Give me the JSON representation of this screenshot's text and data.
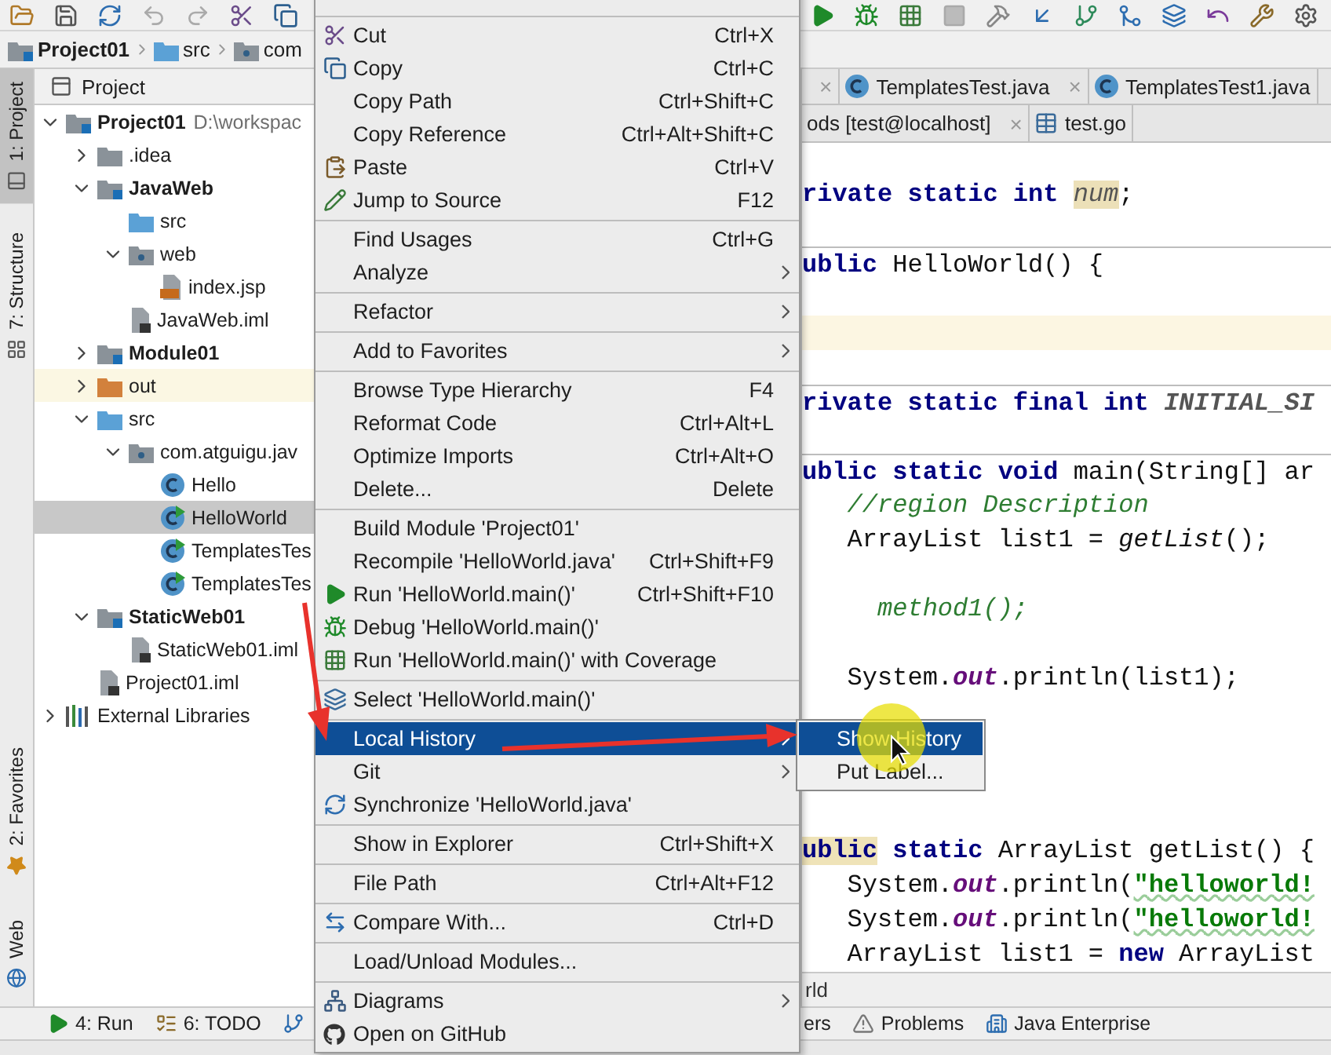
{
  "breadcrumb": [
    {
      "label": "Project01",
      "kind": "module"
    },
    {
      "label": "src",
      "kind": "src"
    },
    {
      "label": "com",
      "kind": "package"
    }
  ],
  "side_stripe": {
    "top": [
      {
        "label": "1: Project",
        "kind": "project",
        "selected": true
      },
      {
        "label": "7: Structure",
        "kind": "structure",
        "selected": false
      }
    ],
    "bottom": [
      {
        "label": "2: Favorites",
        "kind": "star",
        "selected": false
      },
      {
        "label": "Web",
        "kind": "web",
        "selected": false
      }
    ]
  },
  "project_panel": {
    "title": "Project",
    "tree": [
      {
        "label": "Project01",
        "path": "D:\\workspac",
        "kind": "module",
        "expanded": true,
        "selected": false,
        "children": [
          {
            "label": ".idea",
            "kind": "folder",
            "expanded": false,
            "selected": false
          },
          {
            "label": "JavaWeb",
            "kind": "module",
            "expanded": true,
            "selected": false,
            "children": [
              {
                "label": "src",
                "kind": "src",
                "selected": false
              },
              {
                "label": "web",
                "kind": "web",
                "expanded": true,
                "selected": false,
                "children": [
                  {
                    "label": "index.jsp",
                    "kind": "jsp",
                    "selected": false
                  }
                ]
              },
              {
                "label": "JavaWeb.iml",
                "kind": "iml",
                "selected": false
              }
            ]
          },
          {
            "label": "Module01",
            "kind": "module",
            "expanded": false,
            "selected": false
          },
          {
            "label": "out",
            "kind": "excluded",
            "expanded": false,
            "selected": false
          },
          {
            "label": "src",
            "kind": "src",
            "expanded": true,
            "selected": false,
            "children": [
              {
                "label": "com.atguigu.jav",
                "kind": "package",
                "expanded": true,
                "selected": false,
                "children": [
                  {
                    "label": "Hello",
                    "kind": "class",
                    "selected": false
                  },
                  {
                    "label": "HelloWorld",
                    "kind": "main_class",
                    "selected": true
                  },
                  {
                    "label": "TemplatesTes",
                    "kind": "main_class",
                    "selected": false
                  },
                  {
                    "label": "TemplatesTes",
                    "kind": "main_class",
                    "selected": false
                  }
                ]
              }
            ]
          },
          {
            "label": "StaticWeb01",
            "kind": "module",
            "expanded": true,
            "selected": false,
            "children": [
              {
                "label": "StaticWeb01.iml",
                "kind": "iml",
                "selected": false
              }
            ]
          },
          {
            "label": "Project01.iml",
            "kind": "iml",
            "selected": false
          }
        ]
      },
      {
        "label": "External Libraries",
        "kind": "libs",
        "expanded": false,
        "selected": false
      }
    ]
  },
  "editor": {
    "tab_rows": [
      [
        {
          "kind": "plain",
          "close": "×",
          "selected": false
        },
        {
          "kind": "class",
          "label": "TemplatesTest.java",
          "close": "×",
          "selected": false
        },
        {
          "kind": "class",
          "label": "TemplatesTest1.java",
          "selected": false
        }
      ],
      [
        {
          "kind": "plain",
          "label": "ods [test@localhost]",
          "close": "×",
          "selected": false
        },
        {
          "kind": "table",
          "label": "test.go",
          "selected": false
        }
      ]
    ],
    "code_lines": [
      {
        "separator": false,
        "caret": false,
        "segments": [
          {
            "kind": "kw",
            "text": "rivate static int "
          },
          {
            "kind": "field_hl",
            "text": "num"
          },
          {
            "kind": "plain",
            "text": ";"
          }
        ]
      },
      {
        "separator": false,
        "caret": false
      },
      {
        "separator": true,
        "caret": false,
        "segments": [
          {
            "kind": "kw",
            "text": "ublic "
          },
          {
            "kind": "plain",
            "text": "HelloWorld() {"
          }
        ]
      },
      {
        "separator": false,
        "caret": false
      },
      {
        "separator": false,
        "caret": true
      },
      {
        "separator": false,
        "caret": false
      },
      {
        "separator": true,
        "caret": false,
        "segments": [
          {
            "kind": "kw",
            "text": "rivate static final int "
          },
          {
            "kind": "const",
            "text": "INITIAL_SI"
          }
        ]
      },
      {
        "separator": false,
        "caret": false
      },
      {
        "separator": true,
        "caret": false,
        "segments": [
          {
            "kind": "kw",
            "text": "ublic static void "
          },
          {
            "kind": "plain",
            "text": "main(String[] ar"
          }
        ]
      },
      {
        "separator": false,
        "caret": false,
        "segments": [
          {
            "kind": "comment",
            "text": "   //region Description"
          }
        ]
      },
      {
        "separator": false,
        "caret": false,
        "segments": [
          {
            "kind": "plain",
            "text": "   ArrayList list1 = "
          },
          {
            "kind": "call",
            "text": "getList"
          },
          {
            "kind": "plain",
            "text": "();"
          }
        ]
      },
      {
        "separator": false,
        "caret": false
      },
      {
        "separator": false,
        "caret": false,
        "segments": [
          {
            "kind": "comment",
            "text": "     method1();"
          }
        ]
      },
      {
        "separator": false,
        "caret": false
      },
      {
        "separator": false,
        "caret": false,
        "segments": [
          {
            "kind": "plain",
            "text": "   System."
          },
          {
            "kind": "field",
            "text": "out"
          },
          {
            "kind": "plain",
            "text": ".println(list1);"
          }
        ]
      },
      {
        "separator": false,
        "caret": false
      },
      {
        "separator": false,
        "caret": false
      },
      {
        "separator": false,
        "caret": false
      },
      {
        "separator": false,
        "caret": false
      },
      {
        "separator": false,
        "caret": false,
        "segments": [
          {
            "kind": "kw_hl",
            "text": "ublic"
          },
          {
            "kind": "kw",
            "text": " static "
          },
          {
            "kind": "plain",
            "text": "ArrayList getList() {"
          }
        ]
      },
      {
        "separator": false,
        "caret": false,
        "segments": [
          {
            "kind": "plain",
            "text": "   System."
          },
          {
            "kind": "field",
            "text": "out"
          },
          {
            "kind": "plain",
            "text": ".println("
          },
          {
            "kind": "str",
            "text": "\"helloworld!"
          }
        ]
      },
      {
        "separator": false,
        "caret": false,
        "segments": [
          {
            "kind": "plain",
            "text": "   System."
          },
          {
            "kind": "field",
            "text": "out"
          },
          {
            "kind": "plain",
            "text": ".println("
          },
          {
            "kind": "str",
            "text": "\"helloworld!"
          }
        ]
      },
      {
        "separator": false,
        "caret": false,
        "segments": [
          {
            "kind": "plain",
            "text": "   ArrayList list1 = "
          },
          {
            "kind": "kw",
            "text": "new "
          },
          {
            "kind": "plain",
            "text": "ArrayList"
          }
        ]
      }
    ],
    "navigation": "rld"
  },
  "bottom_bar": {
    "left": [
      {
        "kind": "run",
        "label": "4: Run"
      },
      {
        "kind": "todo",
        "label": "6: TODO"
      },
      {
        "kind": "branch"
      }
    ],
    "right": [
      {
        "kind": "plain",
        "label": "ers"
      },
      {
        "kind": "warning",
        "label": "Problems"
      },
      {
        "kind": "enterprise",
        "label": "Java Enterprise"
      }
    ]
  },
  "context_menu": {
    "items": [
      {
        "kind": "separator"
      },
      {
        "kind": "cut",
        "label": "Cut",
        "shortcut": "Ctrl+X",
        "submenu": false,
        "selected": false
      },
      {
        "kind": "copy",
        "label": "Copy",
        "shortcut": "Ctrl+C",
        "submenu": false,
        "selected": false
      },
      {
        "kind": "plain",
        "label": "Copy Path",
        "shortcut": "Ctrl+Shift+C",
        "submenu": false,
        "selected": false
      },
      {
        "kind": "plain",
        "label": "Copy Reference",
        "shortcut": "Ctrl+Alt+Shift+C",
        "submenu": false,
        "selected": false
      },
      {
        "kind": "paste",
        "label": "Paste",
        "shortcut": "Ctrl+V",
        "submenu": false,
        "selected": false
      },
      {
        "kind": "jump",
        "label": "Jump to Source",
        "shortcut": "F12",
        "submenu": false,
        "selected": false
      },
      {
        "kind": "separator"
      },
      {
        "kind": "plain",
        "label": "Find Usages",
        "shortcut": "Ctrl+G",
        "submenu": false,
        "selected": false
      },
      {
        "kind": "plain",
        "label": "Analyze",
        "submenu": true,
        "selected": false
      },
      {
        "kind": "separator"
      },
      {
        "kind": "plain",
        "label": "Refactor",
        "submenu": true,
        "selected": false
      },
      {
        "kind": "separator"
      },
      {
        "kind": "plain",
        "label": "Add to Favorites",
        "submenu": true,
        "selected": false
      },
      {
        "kind": "separator"
      },
      {
        "kind": "plain",
        "label": "Browse Type Hierarchy",
        "shortcut": "F4",
        "submenu": false,
        "selected": false
      },
      {
        "kind": "plain",
        "label": "Reformat Code",
        "shortcut": "Ctrl+Alt+L",
        "submenu": false,
        "selected": false
      },
      {
        "kind": "plain",
        "label": "Optimize Imports",
        "shortcut": "Ctrl+Alt+O",
        "submenu": false,
        "selected": false
      },
      {
        "kind": "plain",
        "label": "Delete...",
        "shortcut": "Delete",
        "submenu": false,
        "selected": false
      },
      {
        "kind": "separator"
      },
      {
        "kind": "plain",
        "label": "Build Module 'Project01'",
        "submenu": false,
        "selected": false
      },
      {
        "kind": "plain",
        "label": "Recompile 'HelloWorld.java'",
        "shortcut": "Ctrl+Shift+F9",
        "submenu": false,
        "selected": false
      },
      {
        "kind": "run",
        "label": "Run 'HelloWorld.main()'",
        "shortcut": "Ctrl+Shift+F10",
        "submenu": false,
        "selected": false
      },
      {
        "kind": "debug",
        "label": "Debug 'HelloWorld.main()'",
        "submenu": false,
        "selected": false
      },
      {
        "kind": "coverage",
        "label": "Run 'HelloWorld.main()' with Coverage",
        "submenu": false,
        "selected": false
      },
      {
        "kind": "separator"
      },
      {
        "kind": "select",
        "label": "Select 'HelloWorld.main()'",
        "submenu": false,
        "selected": false
      },
      {
        "kind": "separator"
      },
      {
        "kind": "plain",
        "label": "Local History",
        "submenu": true,
        "selected": true
      },
      {
        "kind": "plain",
        "label": "Git",
        "submenu": true,
        "selected": false
      },
      {
        "kind": "sync",
        "label": "Synchronize 'HelloWorld.java'",
        "submenu": false,
        "selected": false
      },
      {
        "kind": "separator"
      },
      {
        "kind": "plain",
        "label": "Show in Explorer",
        "shortcut": "Ctrl+Shift+X",
        "submenu": false,
        "selected": false
      },
      {
        "kind": "separator"
      },
      {
        "kind": "plain",
        "label": "File Path",
        "shortcut": "Ctrl+Alt+F12",
        "submenu": false,
        "selected": false
      },
      {
        "kind": "separator"
      },
      {
        "kind": "compare",
        "label": "Compare With...",
        "shortcut": "Ctrl+D",
        "submenu": false,
        "selected": false
      },
      {
        "kind": "separator"
      },
      {
        "kind": "plain",
        "label": "Load/Unload Modules...",
        "submenu": false,
        "selected": false
      },
      {
        "kind": "separator"
      },
      {
        "kind": "diagrams",
        "label": "Diagrams",
        "submenu": true,
        "selected": false
      },
      {
        "kind": "github",
        "label": "Open on GitHub",
        "submenu": false,
        "selected": false
      }
    ]
  },
  "submenu": {
    "items": [
      {
        "label": "Show History",
        "selected": true
      },
      {
        "label": "Put Label...",
        "selected": false
      }
    ]
  }
}
